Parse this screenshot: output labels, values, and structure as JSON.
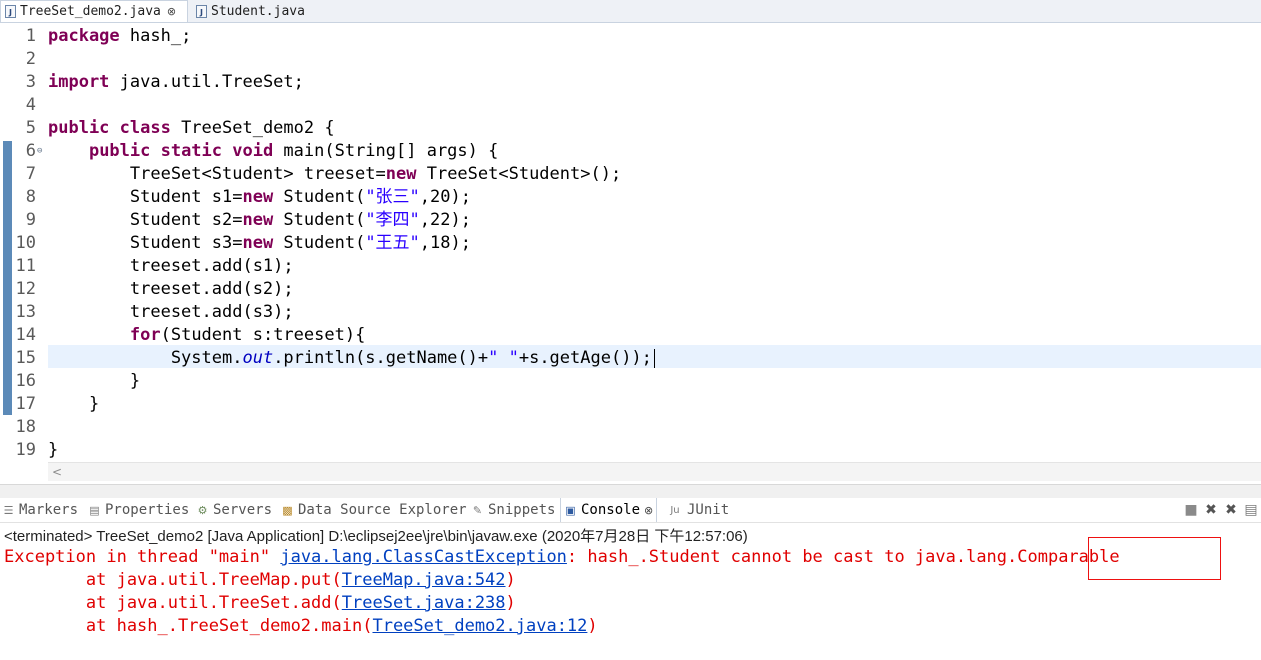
{
  "tabs": [
    {
      "label": "TreeSet_demo2.java",
      "close": "⊗",
      "active": true
    },
    {
      "label": "Student.java",
      "active": false
    }
  ],
  "editor": {
    "line_numbers": [
      "1",
      "2",
      "3",
      "4",
      "5",
      "6",
      "7",
      "8",
      "9",
      "10",
      "11",
      "12",
      "13",
      "14",
      "15",
      "16",
      "17",
      "18",
      "19"
    ],
    "fold_marker": "⊖",
    "lines": {
      "l1": {
        "kw": "package",
        "rest": " hash_;"
      },
      "l3": {
        "kw": "import",
        "rest": " java.util.TreeSet;"
      },
      "l5": {
        "kw": "public class",
        "rest": " TreeSet_demo2 {"
      },
      "l6": {
        "indent": "    ",
        "kw": "public static void",
        "rest": " main(String[] args) {"
      },
      "l7": {
        "a": "        TreeSet<Student> treeset=",
        "kw": "new",
        "b": " TreeSet<Student>();"
      },
      "l8": {
        "a": "        Student s1=",
        "kw": "new",
        "b": " Student(",
        "str": "\"张三\"",
        "c": ",20);"
      },
      "l9": {
        "a": "        Student s2=",
        "kw": "new",
        "b": " Student(",
        "str": "\"李四\"",
        "c": ",22);"
      },
      "l10": {
        "a": "        Student s3=",
        "kw": "new",
        "b": " Student(",
        "str": "\"王五\"",
        "c": ",18);"
      },
      "l11": "        treeset.add(s1);",
      "l12": "        treeset.add(s2);",
      "l13": "        treeset.add(s3);",
      "l14": {
        "indent": "        ",
        "kw": "for",
        "rest": "(Student s:treeset){"
      },
      "l15": {
        "a": "            System.",
        "fld": "out",
        "b": ".println(s.getName()+",
        "str": "\" \"",
        "c": "+s.getAge());"
      },
      "l16": "        }",
      "l17": "    }",
      "l19": "}"
    },
    "scroll_left": "<"
  },
  "views": {
    "tabs": [
      {
        "label": "Markers",
        "icon": "markers-icon"
      },
      {
        "label": "Properties",
        "icon": "properties-icon"
      },
      {
        "label": "Servers",
        "icon": "servers-icon"
      },
      {
        "label": "Data Source Explorer",
        "icon": "data-source-icon"
      },
      {
        "label": "Snippets",
        "icon": "snippets-icon"
      },
      {
        "label": "Console",
        "icon": "console-icon",
        "active": true,
        "close": "⊗"
      },
      {
        "label": "JUnit",
        "icon": "junit-icon",
        "glyph": "Ju"
      }
    ]
  },
  "console": {
    "status": "<terminated> TreeSet_demo2 [Java Application] D:\\eclipsej2ee\\jre\\bin\\javaw.exe (2020年7月28日 下午12:57:06)",
    "ex_prefix": "Exception in thread \"main\" ",
    "ex_class": "java.lang.ClassCastException",
    "ex_msg": ": hash_.Student cannot be cast to java.lang.Comparable",
    "trace": [
      {
        "pre": "        at java.util.TreeMap.put(",
        "link": "TreeMap.java:542",
        "post": ")"
      },
      {
        "pre": "        at java.util.TreeSet.add(",
        "link": "TreeSet.java:238",
        "post": ")"
      },
      {
        "pre": "        at hash_.TreeSet_demo2.main(",
        "link": "TreeSet_demo2.java:12",
        "post": ")"
      }
    ]
  },
  "colors": {
    "keyword": "#7f0055",
    "string": "#2a00ff",
    "error": "#e00000",
    "link": "#0040c0",
    "highlight_box": "#ee1111"
  }
}
